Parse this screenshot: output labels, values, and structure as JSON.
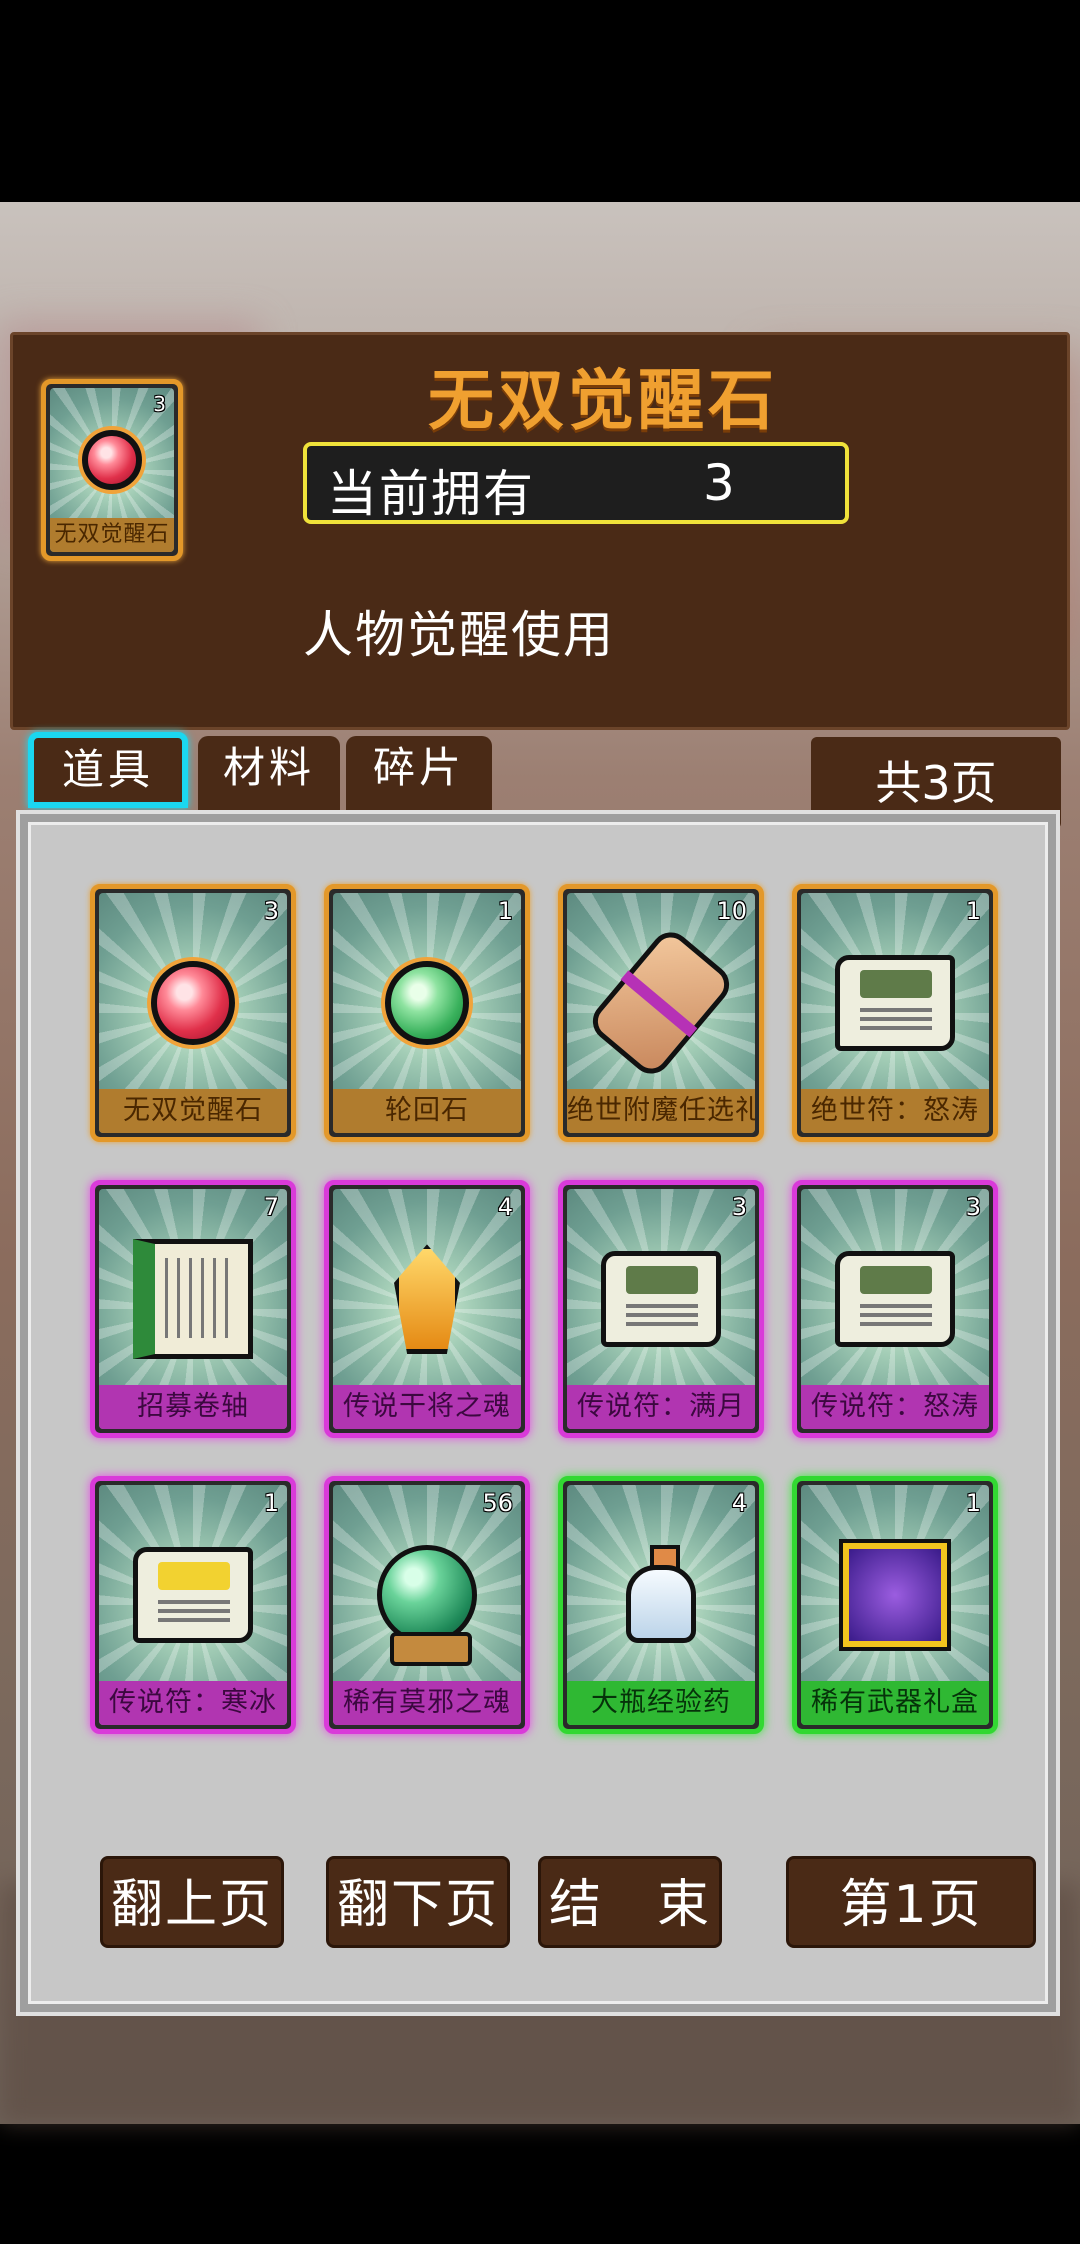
{
  "detail": {
    "title": "无双觉醒石",
    "owned_label": "当前拥有",
    "owned_value": "3",
    "description": "人物觉醒使用",
    "card": {
      "name": "无双觉醒石",
      "count": "3",
      "rarity": "gold",
      "icon": "red-orb-icon"
    }
  },
  "tabs": [
    {
      "label": "道具",
      "active": true
    },
    {
      "label": "材料",
      "active": false
    },
    {
      "label": "碎片",
      "active": false
    }
  ],
  "total_pages": "共3页",
  "items": [
    {
      "name": "无双觉醒石",
      "count": "3",
      "rarity": "gold",
      "icon": "red-orb-icon"
    },
    {
      "name": "轮回石",
      "count": "1",
      "rarity": "gold",
      "icon": "green-orb-icon"
    },
    {
      "name": "绝世附魔任选礼盒",
      "count": "10",
      "rarity": "gold",
      "icon": "parchment-icon"
    },
    {
      "name": "绝世符：怒涛",
      "count": "1",
      "rarity": "gold",
      "icon": "scroll-icon"
    },
    {
      "name": "招募卷轴",
      "count": "7",
      "rarity": "purple",
      "icon": "long-scroll-icon"
    },
    {
      "name": "传说干将之魂",
      "count": "4",
      "rarity": "purple",
      "icon": "crystal-icon"
    },
    {
      "name": "传说符：满月",
      "count": "3",
      "rarity": "purple",
      "icon": "scroll-icon"
    },
    {
      "name": "传说符：怒涛",
      "count": "3",
      "rarity": "purple",
      "icon": "scroll-icon"
    },
    {
      "name": "传说符：寒冰",
      "count": "1",
      "rarity": "purple",
      "icon": "gem-scroll-icon"
    },
    {
      "name": "稀有莫邪之魂",
      "count": "56",
      "rarity": "purple",
      "icon": "globe-icon"
    },
    {
      "name": "大瓶经验药",
      "count": "4",
      "rarity": "green",
      "icon": "bottle-icon"
    },
    {
      "name": "稀有武器礼盒",
      "count": "1",
      "rarity": "green",
      "icon": "cube-icon"
    }
  ],
  "buttons": {
    "prev": "翻上页",
    "next": "翻下页",
    "end": "结　束",
    "current_page": "第1页"
  }
}
